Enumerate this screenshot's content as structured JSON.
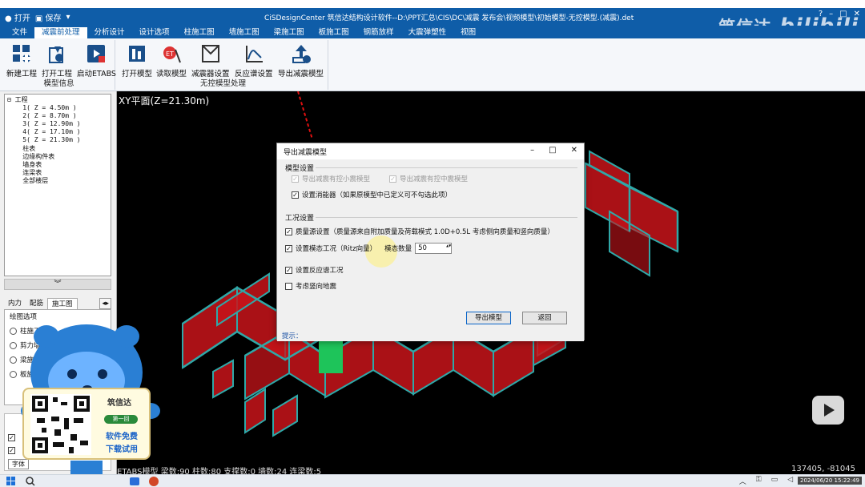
{
  "titlebar": {
    "open_label": "打开",
    "save_label": "保存",
    "title": "CiSDesignCenter 筑信达结构设计软件--D:\\PPT汇总\\CIS\\DC\\减震 发布会\\视频模型\\初始模型-无控模型.(减震).det"
  },
  "menu": [
    {
      "label": "文件"
    },
    {
      "label": "减震前处理"
    },
    {
      "label": "分析设计"
    },
    {
      "label": "设计选项"
    },
    {
      "label": "柱施工图"
    },
    {
      "label": "墙施工图"
    },
    {
      "label": "梁施工图"
    },
    {
      "label": "板施工图"
    },
    {
      "label": "钢筋放样"
    },
    {
      "label": "大震弹塑性"
    },
    {
      "label": "视图"
    }
  ],
  "brand": {
    "text": "筑信达",
    "bili": "bilibili"
  },
  "ribbon": {
    "group1": {
      "title": "模型信息",
      "buttons": [
        "新建工程",
        "打开工程",
        "启动ETABS"
      ]
    },
    "group2": {
      "title": "无控模型处理",
      "buttons": [
        "打开模型",
        "读取模型",
        "减震器设置",
        "反应谱设置",
        "导出减震模型"
      ]
    }
  },
  "tree": [
    "⊟ 工程",
    "    1( Z = 4.50m )",
    "    2( Z = 8.70m )",
    "    3( Z = 12.90m )",
    "    4( Z = 17.10m )",
    "    5( Z = 21.30m )",
    "    柱表",
    "    边缘构件表",
    "    墙身表",
    "    连梁表",
    "    全部楼层"
  ],
  "collapse_icon": "double-chevron-down-icon",
  "leftTabs": [
    "内力",
    "配筋",
    "施工图"
  ],
  "drawOpts": {
    "title": "绘图选项",
    "items": [
      "柱施工图",
      "剪力墙",
      "梁施",
      "板施"
    ],
    "extra": "工图"
  },
  "lower": {
    "font_button": "字体"
  },
  "canvas": {
    "view_label": "XY平面(Z=21.30m)",
    "status_text": "ETABS模型 梁数:90 柱数:80 支撑数:0 墙数:24 连梁数:5",
    "coords": "137405, -81045"
  },
  "dialog": {
    "title": "导出减震模型",
    "group_model": "模型设置",
    "opt_small": "导出减震有控小震模型",
    "opt_medium": "导出减震有控中震模型",
    "opt_damper": "设置消能器（如果原模型中已定义可不勾选此项）",
    "group_case": "工况设置",
    "opt_mass": "质量源设置（质量源来自附加质量及荷载模式 1.0D+0.5L 考虑侧向质量和竖向质量）",
    "opt_modal": "设置模态工况（Ritz向量）",
    "mode_count_label": "模态数量",
    "mode_count": "50",
    "opt_spectrum": "设置反应谱工况",
    "opt_vertical": "考虑竖向地震",
    "export_button": "导出模型",
    "return_button": "返回",
    "hint": "提示："
  },
  "mascot": {
    "name": "筑信达",
    "chip": "第一回",
    "line1": "软件免费",
    "line2": "下载试用"
  },
  "taskbar": {
    "time": "2024/06/20 15:22:49"
  },
  "colors": {
    "titlebar": "#0f5da8",
    "wall": "#d11a1a",
    "beam": "#2fa8a8",
    "green": "#1ec45a"
  }
}
